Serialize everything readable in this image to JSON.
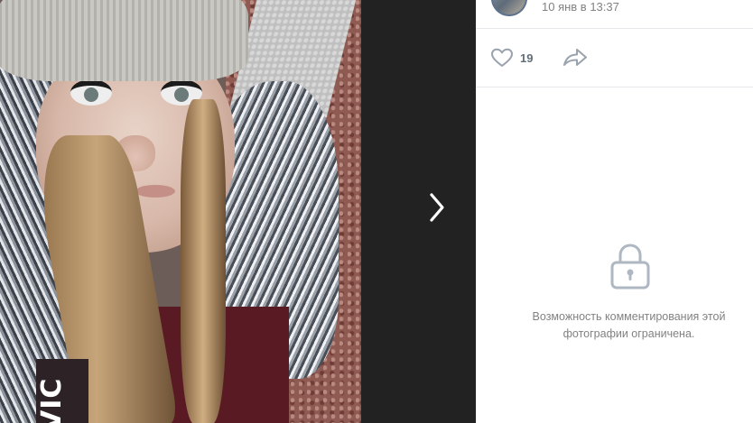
{
  "viewer": {
    "photo_shirt_text": "VIC",
    "next_icon": "chevron-right-icon"
  },
  "post": {
    "timestamp": "10 янв в 13:37"
  },
  "actions": {
    "like_icon": "heart-icon",
    "like_count": "19",
    "share_icon": "share-arrow-icon"
  },
  "comments": {
    "restricted_icon": "lock-icon",
    "restricted_message": "Возможность комментирования этой фотографии ограничена."
  },
  "colors": {
    "viewer_background": "#222222",
    "sidebar_background": "#ffffff",
    "muted_text": "#828282",
    "icon_blue": "#99a2ad",
    "divider": "#e7e8ec"
  }
}
